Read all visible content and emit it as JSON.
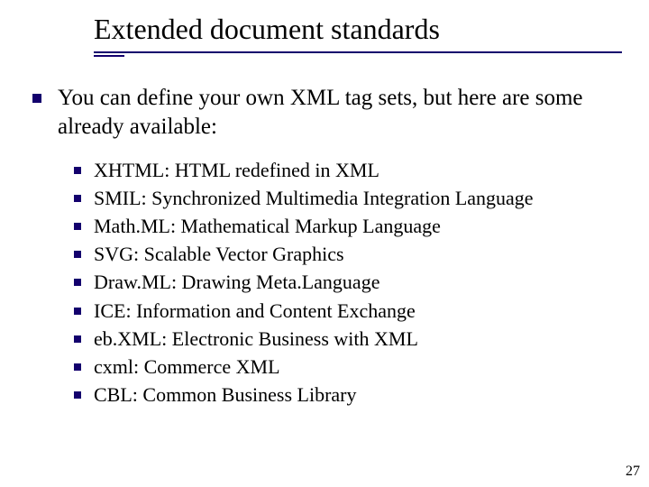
{
  "title": "Extended document standards",
  "intro": "You can define your own XML tag sets, but here are some already available:",
  "items": [
    "XHTML: HTML redefined in XML",
    "SMIL: Synchronized Multimedia Integration Language",
    "Math.ML: Mathematical Markup Language",
    "SVG: Scalable Vector Graphics",
    "Draw.ML: Drawing Meta.Language",
    "ICE: Information and Content Exchange",
    "eb.XML: Electronic Business with XML",
    "cxml: Commerce XML",
    "CBL: Common Business Library"
  ],
  "page_number": "27",
  "colors": {
    "accent": "#13006d"
  }
}
